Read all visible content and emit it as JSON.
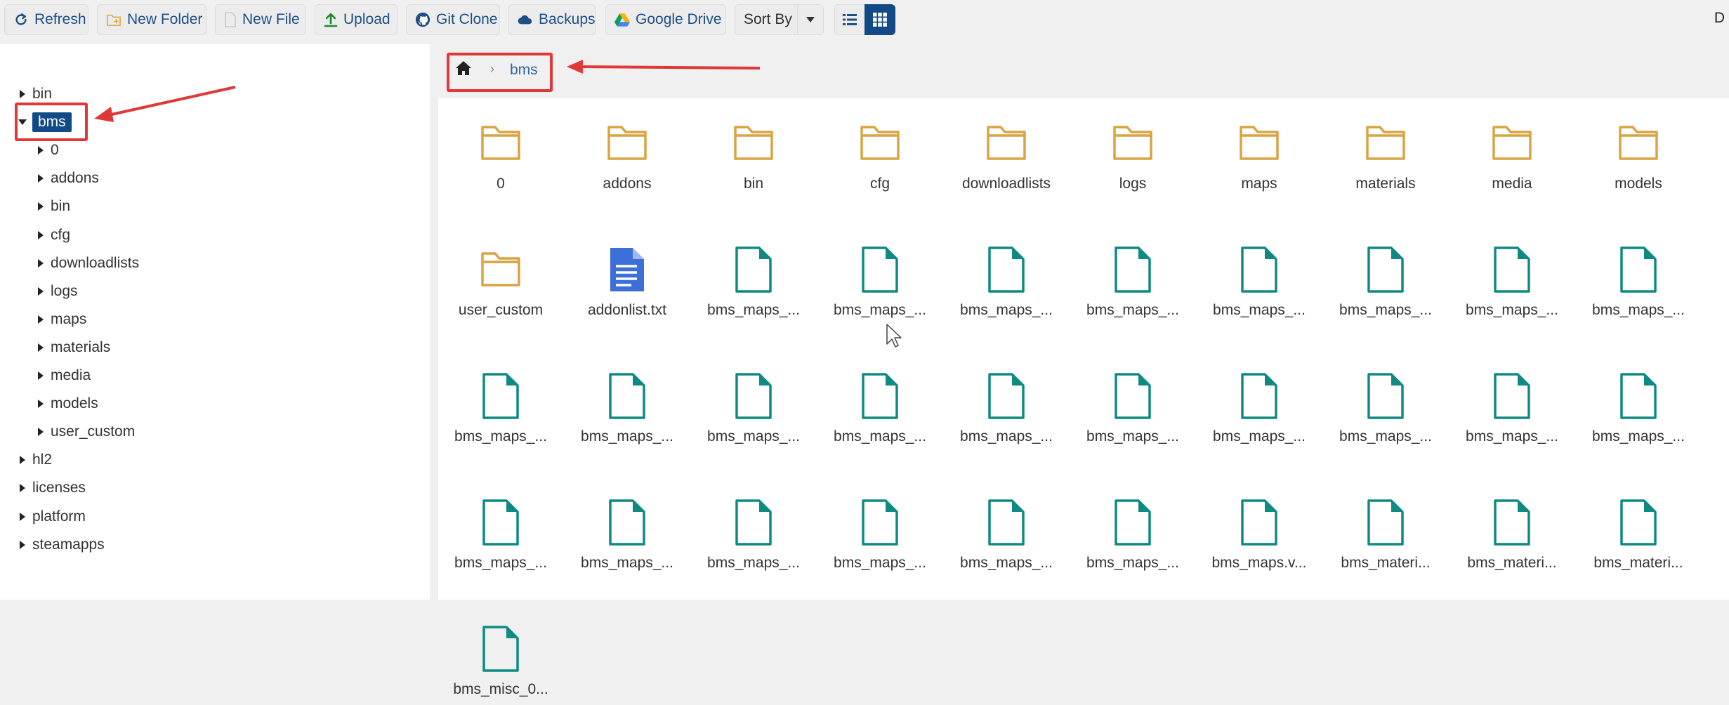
{
  "toolbar": {
    "refresh": "Refresh",
    "new_folder": "New Folder",
    "new_file": "New File",
    "upload": "Upload",
    "git_clone": "Git Clone",
    "backups": "Backups",
    "google_drive": "Google Drive",
    "sort_by": "Sort By",
    "cutoff_text": "D"
  },
  "tree": {
    "root_items": [
      "bin",
      "bms",
      "hl2",
      "licenses",
      "platform",
      "steamapps"
    ],
    "selected": "bms",
    "bms_children": [
      "0",
      "addons",
      "bin",
      "cfg",
      "downloadlists",
      "logs",
      "maps",
      "materials",
      "media",
      "models",
      "user_custom"
    ]
  },
  "breadcrumb": {
    "home_icon": "home-icon",
    "current": "bms"
  },
  "files": [
    {
      "name": "0",
      "type": "folder"
    },
    {
      "name": "addons",
      "type": "folder"
    },
    {
      "name": "bin",
      "type": "folder"
    },
    {
      "name": "cfg",
      "type": "folder"
    },
    {
      "name": "downloadlists",
      "type": "folder"
    },
    {
      "name": "logs",
      "type": "folder"
    },
    {
      "name": "maps",
      "type": "folder"
    },
    {
      "name": "materials",
      "type": "folder"
    },
    {
      "name": "media",
      "type": "folder"
    },
    {
      "name": "models",
      "type": "folder"
    },
    {
      "name": "user_custom",
      "type": "folder"
    },
    {
      "name": "addonlist.txt",
      "type": "text"
    },
    {
      "name": "bms_maps_...",
      "type": "file"
    },
    {
      "name": "bms_maps_...",
      "type": "file"
    },
    {
      "name": "bms_maps_...",
      "type": "file"
    },
    {
      "name": "bms_maps_...",
      "type": "file"
    },
    {
      "name": "bms_maps_...",
      "type": "file"
    },
    {
      "name": "bms_maps_...",
      "type": "file"
    },
    {
      "name": "bms_maps_...",
      "type": "file"
    },
    {
      "name": "bms_maps_...",
      "type": "file"
    },
    {
      "name": "bms_maps_...",
      "type": "file"
    },
    {
      "name": "bms_maps_...",
      "type": "file"
    },
    {
      "name": "bms_maps_...",
      "type": "file"
    },
    {
      "name": "bms_maps_...",
      "type": "file"
    },
    {
      "name": "bms_maps_...",
      "type": "file"
    },
    {
      "name": "bms_maps_...",
      "type": "file"
    },
    {
      "name": "bms_maps_...",
      "type": "file"
    },
    {
      "name": "bms_maps_...",
      "type": "file"
    },
    {
      "name": "bms_maps_...",
      "type": "file"
    },
    {
      "name": "bms_maps_...",
      "type": "file"
    },
    {
      "name": "bms_maps_...",
      "type": "file"
    },
    {
      "name": "bms_maps_...",
      "type": "file"
    },
    {
      "name": "bms_maps_...",
      "type": "file"
    },
    {
      "name": "bms_maps_...",
      "type": "file"
    },
    {
      "name": "bms_maps_...",
      "type": "file"
    },
    {
      "name": "bms_maps_...",
      "type": "file"
    },
    {
      "name": "bms_maps.v...",
      "type": "file"
    },
    {
      "name": "bms_materi...",
      "type": "file"
    },
    {
      "name": "bms_materi...",
      "type": "file"
    },
    {
      "name": "bms_materi...",
      "type": "file"
    },
    {
      "name": "bms_misc_0...",
      "type": "file"
    }
  ],
  "colors": {
    "accent": "#114a86",
    "folder": "#d9a441",
    "file": "#0e8a83",
    "text_file": "#3d6fd8",
    "annotation": "#e03838"
  }
}
